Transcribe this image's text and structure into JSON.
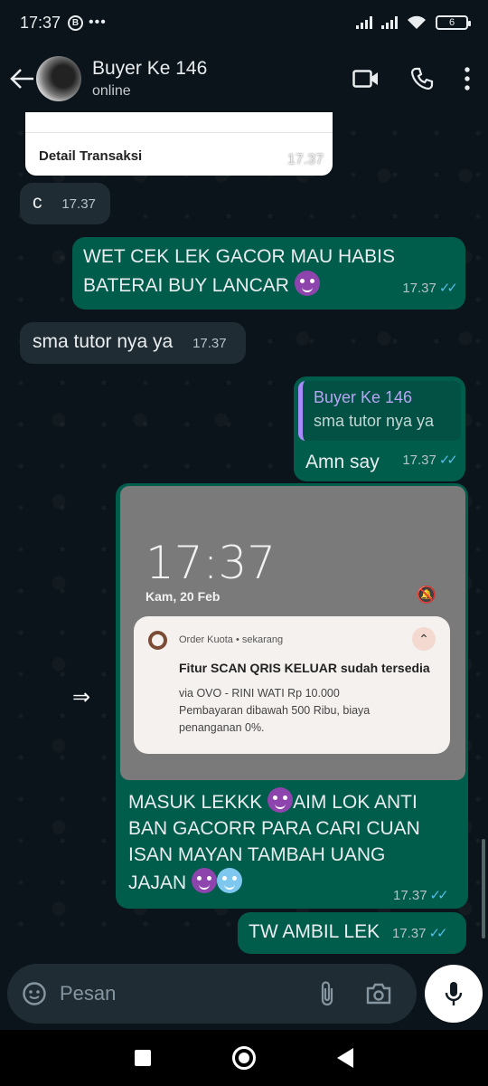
{
  "status_bar": {
    "time": "17:37",
    "b_icon": "B",
    "dots": "•••",
    "battery": "6"
  },
  "header": {
    "contact_name": "Buyer Ke 146",
    "status": "online"
  },
  "messages": {
    "card": {
      "label": "Detail Transaksi",
      "time": "17.37"
    },
    "m1": {
      "text": "c",
      "time": "17.37"
    },
    "m2": {
      "text_a": "WET CEK LEK GACOR MAU HABIS",
      "text_b": "BATERAI BUY LANCAR",
      "time": "17.37"
    },
    "m3": {
      "text": "sma tutor nya ya",
      "time": "17.37"
    },
    "m4": {
      "quote_name": "Buyer Ke 146",
      "quote_text": "sma tutor nya ya",
      "text": "Amn say",
      "time": "17.37"
    },
    "m5": {
      "image": {
        "clock": "17:37",
        "date": "Kam, 20 Feb",
        "notification": {
          "app": "Order Kuota • sekarang",
          "title": "Fitur SCAN QRIS KELUAR sudah tersedia",
          "line1": "via OVO - RINI WATI Rp 10.000",
          "line2": "Pembayaran dibawah 500 Ribu, biaya",
          "line3": "penanganan 0%."
        }
      },
      "line1_a": "MASUK LEKKK",
      "line1_b": "AIM LOK ANTI",
      "line2": "BAN GACORR PARA CARI CUAN",
      "line3": "ISAN MAYAN TAMBAH UANG",
      "line4": "JAJAN",
      "time": "17.37"
    },
    "m6": {
      "text": "TW AMBIL LEK",
      "time": "17.37"
    }
  },
  "input": {
    "placeholder": "Pesan"
  },
  "colors": {
    "incoming": "#202c33",
    "outgoing": "#005c4b",
    "tick": "#53bdeb",
    "background": "#0b141a"
  },
  "icons": [
    "back-arrow-icon",
    "video-call-icon",
    "phone-icon",
    "more-vert-icon",
    "sticker-icon",
    "attach-icon",
    "camera-icon",
    "mic-icon",
    "forward-icon"
  ]
}
